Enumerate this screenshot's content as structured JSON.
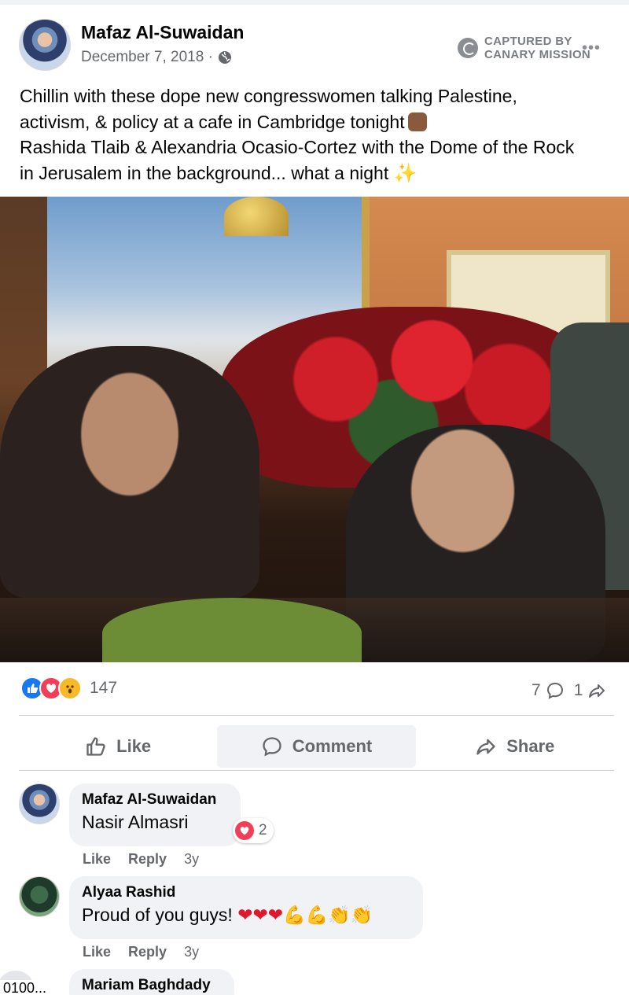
{
  "post": {
    "author": "Mafaz Al-Suwaidan",
    "date": "December 7, 2018 ·",
    "privacy_icon": "globe-icon",
    "text_lines": [
      "Chillin with these dope new congresswomen talking Palestine,",
      "activism, & policy at a cafe in Cambridge tonight",
      "Rashida Tlaib & Alexandria Ocasio-Cortez with the Dome of the Rock",
      "in Jerusalem in the background... what a night"
    ],
    "emoji_fist": "fist-emoji",
    "emoji_sparkles": "✨"
  },
  "watermark": {
    "line1": "CAPTURED BY",
    "line2": "CANARY MISSION",
    "more": "•••"
  },
  "stats": {
    "reaction_icons": [
      "like-icon",
      "love-icon",
      "wow-icon"
    ],
    "reaction_count": "147",
    "comment_count": "7",
    "share_count": "1"
  },
  "actions": {
    "like": "Like",
    "comment": "Comment",
    "share": "Share"
  },
  "comments": [
    {
      "name": "Mafaz Al-Suwaidan",
      "text": "Nasir Almasri",
      "reaction_count": "2",
      "like": "Like",
      "reply": "Reply",
      "time": "3y"
    },
    {
      "name": "Alyaa Rashid",
      "text": "Proud of you guys!",
      "emojis_hearts": "❤❤❤",
      "emojis_other": "💪💪👏👏",
      "like": "Like",
      "reply": "Reply",
      "time": "3y"
    },
    {
      "name": "Mariam Baghdady",
      "avatar_label": "0100..."
    }
  ],
  "colors": {
    "brand_blue": "#1877f2",
    "love_red": "#f33e58",
    "wow_yellow": "#f7b928",
    "secondary_text": "#65676b"
  }
}
